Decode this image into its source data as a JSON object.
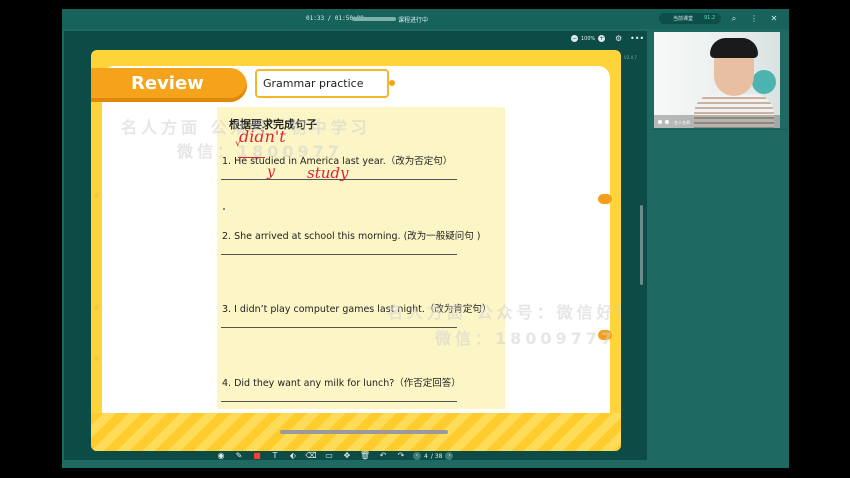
{
  "titlebar": {
    "time": "01:33 / 01:50:00",
    "status": "课程进行中",
    "pill_left": "当前课堂",
    "pill_value": "91.2",
    "progress": 0.0141
  },
  "stage": {
    "zoom": "100%",
    "version": "V2.4.7"
  },
  "slide": {
    "review": "Review",
    "section": "Grammar practice",
    "heading": "根据要求完成句子",
    "questions": [
      "1. He studied in America last year.（改为否定句）",
      "2. She arrived at school this morning. (改为一般疑问句 )",
      "3. I didn’t play computer games last night.（改为肯定句）",
      "4. Did they want any milk for lunch?（作否定回答）"
    ],
    "ink": {
      "didnt": "didn't",
      "y": "y",
      "study": "study"
    },
    "watermarks": [
      "名人方面 公众号：初中学习",
      "微信：1800977",
      "名人方面 公众号：微信好学习",
      "微信：18009777"
    ]
  },
  "pager": {
    "current": "4",
    "total": "/ 38"
  },
  "video": {
    "label": "名人名师"
  },
  "colors": {
    "brand": "#1e6a63",
    "slide_yellow": "#ffd43a",
    "review_orange": "#f5a31a",
    "ink_red": "#e0213a",
    "paper": "#fcf6c6"
  }
}
